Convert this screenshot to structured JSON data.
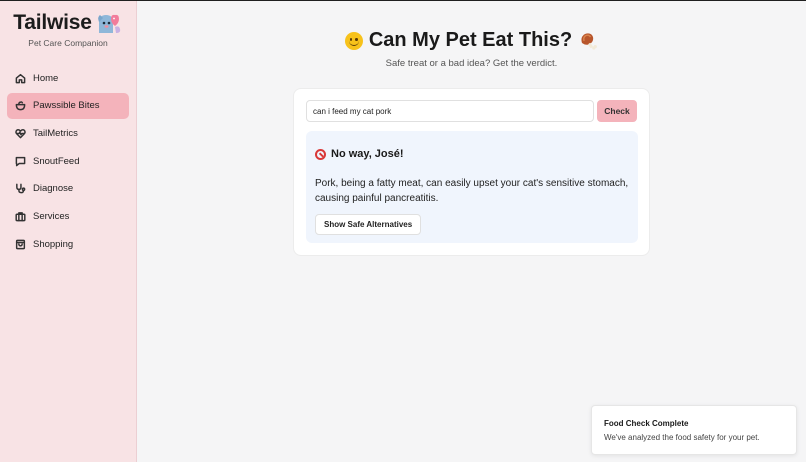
{
  "brand": {
    "name": "Tailwise",
    "subtitle": "Pet Care Companion"
  },
  "sidebar": {
    "items": [
      {
        "label": "Home",
        "icon": "home-icon",
        "active": false
      },
      {
        "label": "Pawssible Bites",
        "icon": "bowl-icon",
        "active": true
      },
      {
        "label": "TailMetrics",
        "icon": "heart-pulse-icon",
        "active": false
      },
      {
        "label": "SnoutFeed",
        "icon": "chat-bubble-icon",
        "active": false
      },
      {
        "label": "Diagnose",
        "icon": "stethoscope-icon",
        "active": false
      },
      {
        "label": "Services",
        "icon": "briefcase-icon",
        "active": false
      },
      {
        "label": "Shopping",
        "icon": "shopping-bag-icon",
        "active": false
      }
    ]
  },
  "main": {
    "title": "Can My Pet Eat This?",
    "subtitle": "Safe treat or a bad idea? Get the verdict.",
    "search": {
      "value": "can i feed my cat pork",
      "placeholder": ""
    },
    "check_label": "Check",
    "verdict": {
      "title": "No way, José!",
      "text": "Pork, being a fatty meat, can easily upset your cat's sensitive stomach, causing painful pancreatitis.",
      "alternatives_label": "Show Safe Alternatives"
    }
  },
  "toast": {
    "title": "Food Check Complete",
    "message": "We've analyzed the food safety for your pet."
  },
  "colors": {
    "sidebar_bg": "#f8e3e5",
    "accent": "#f4b3bb",
    "verdict_bg": "#f0f5fd",
    "danger": "#d93838"
  }
}
